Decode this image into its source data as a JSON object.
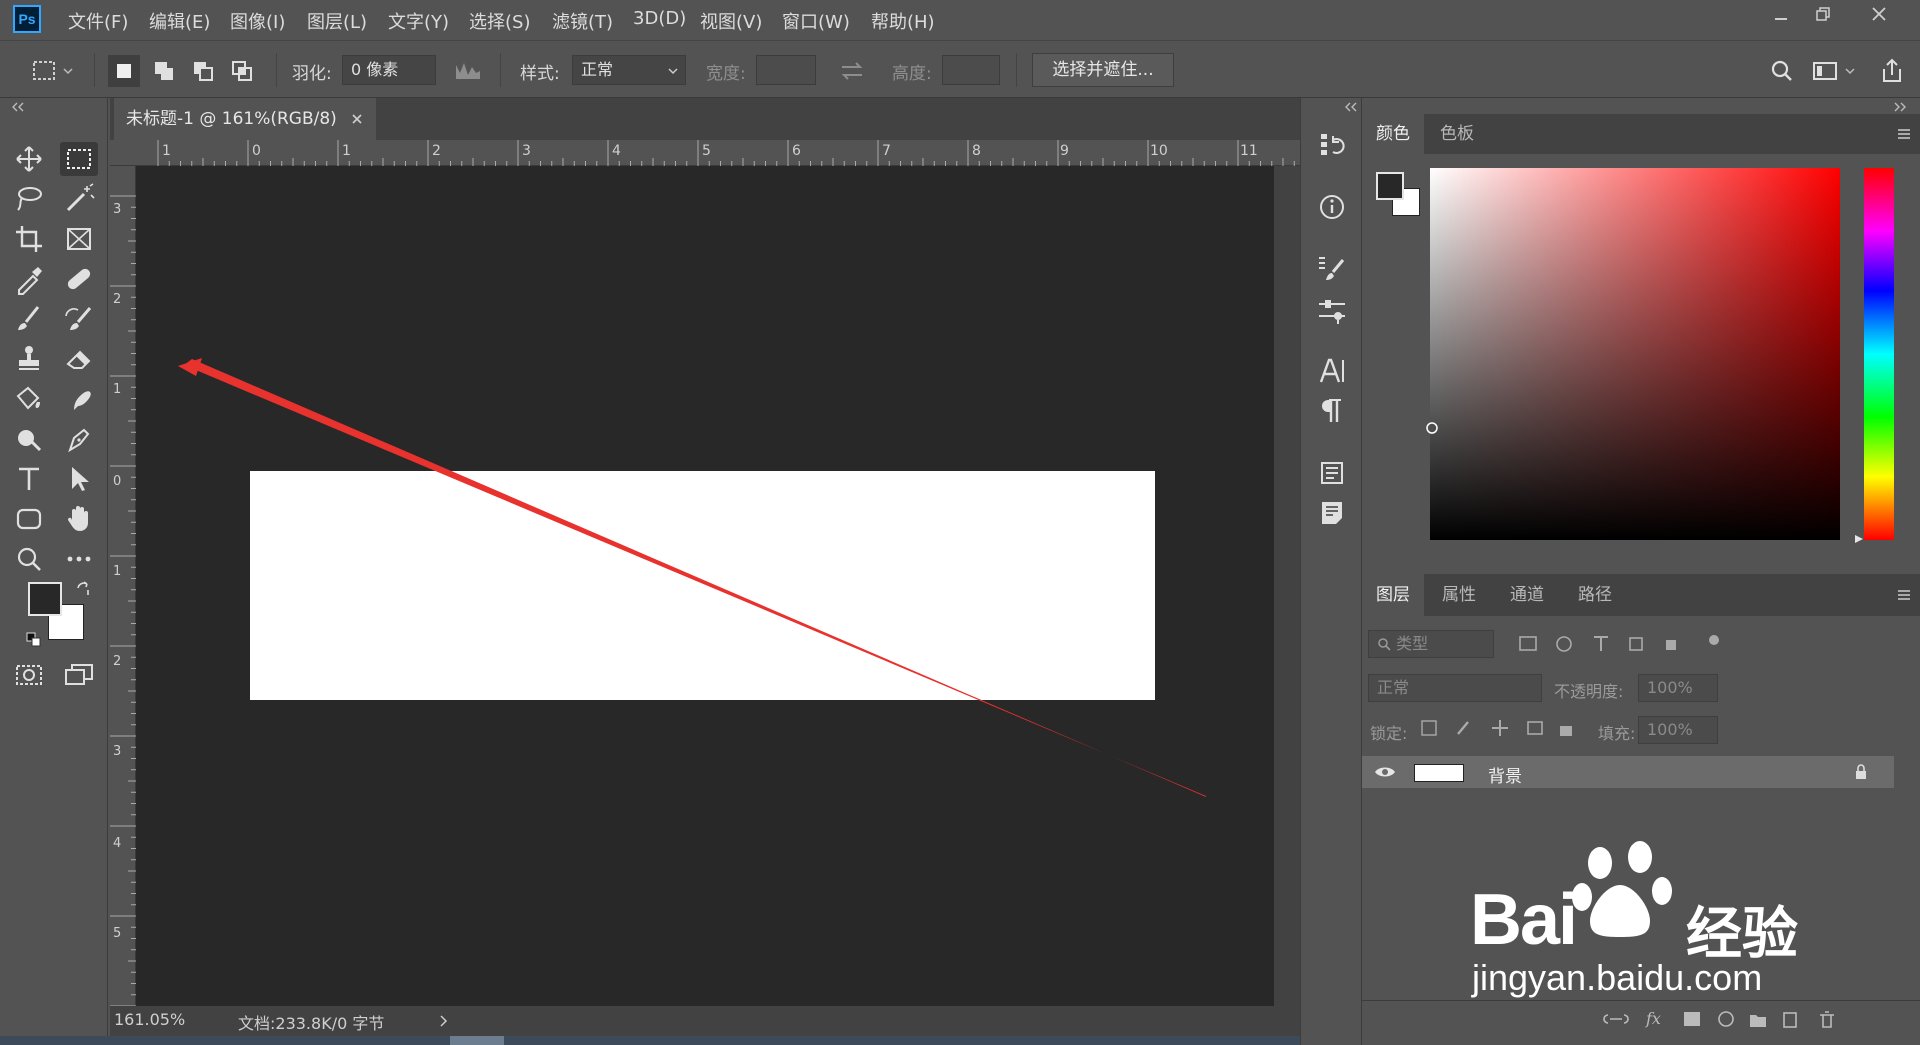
{
  "app": {
    "logo_text": "Ps"
  },
  "menu": [
    "文件(F)",
    "编辑(E)",
    "图像(I)",
    "图层(L)",
    "文字(Y)",
    "选择(S)",
    "滤镜(T)",
    "3D(D)",
    "视图(V)",
    "窗口(W)",
    "帮助(H)"
  ],
  "options": {
    "feather_label": "羽化:",
    "feather_value": "0 像素",
    "style_label": "样式:",
    "style_value": "正常",
    "width_label": "宽度:",
    "height_label": "高度:",
    "select_mask_label": "选择并遮住..."
  },
  "document": {
    "tab_title": "未标题-1 @ 161%(RGB/8)",
    "zoom": "161.05%",
    "doc_info": "文档:233.8K/0 字节",
    "ruler_top_labels": [
      "1",
      "0",
      "1",
      "2",
      "3",
      "4",
      "5",
      "6",
      "7",
      "8",
      "9",
      "10",
      "11"
    ],
    "ruler_left_labels": [
      "3",
      "2",
      "1",
      "0",
      "1",
      "2",
      "3",
      "4",
      "5"
    ]
  },
  "color_panel": {
    "tabs": [
      "颜色",
      "色板"
    ]
  },
  "layers_panel": {
    "tabs": [
      "图层",
      "属性",
      "通道",
      "路径"
    ],
    "filter_placeholder": "类型",
    "blend_mode": "正常",
    "opacity_label": "不透明度:",
    "opacity_value": "100%",
    "lock_label": "锁定:",
    "fill_label": "填充:",
    "fill_value": "100%",
    "layers": [
      {
        "name": "背景",
        "locked": true,
        "visible": true
      }
    ]
  },
  "watermark": {
    "brand": "Bai",
    "brand2": "经验",
    "url": "jingyan.baidu.com"
  },
  "colors": {
    "accent_red": "#e8322e",
    "panel_bg": "#535353",
    "pasteboard": "#282828"
  }
}
